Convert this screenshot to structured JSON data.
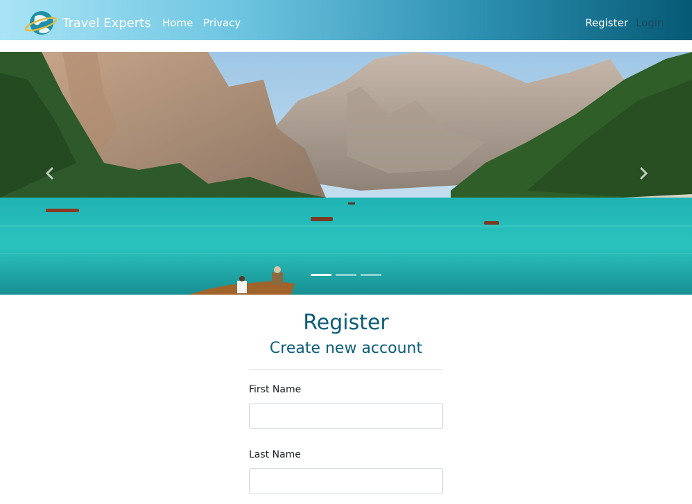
{
  "navbar": {
    "brand": "Travel Experts",
    "links": {
      "home": "Home",
      "privacy": "Privacy",
      "register": "Register",
      "login": "Login"
    }
  },
  "carousel": {
    "slide_count": 3,
    "active_slide": 1,
    "image": "mountain-lake-with-boats",
    "prev_icon": "chevron-left-icon",
    "next_icon": "chevron-right-icon"
  },
  "form": {
    "title": "Register",
    "subtitle": "Create new account",
    "fields": [
      {
        "label": "First Name",
        "value": "",
        "placeholder": ""
      },
      {
        "label": "Last Name",
        "value": "",
        "placeholder": ""
      }
    ]
  },
  "colors": {
    "navbar_gradient_start": "#a9e4f6",
    "navbar_gradient_end": "#065a75",
    "heading": "#0b5d78",
    "login_link": "#1a4a5e"
  }
}
